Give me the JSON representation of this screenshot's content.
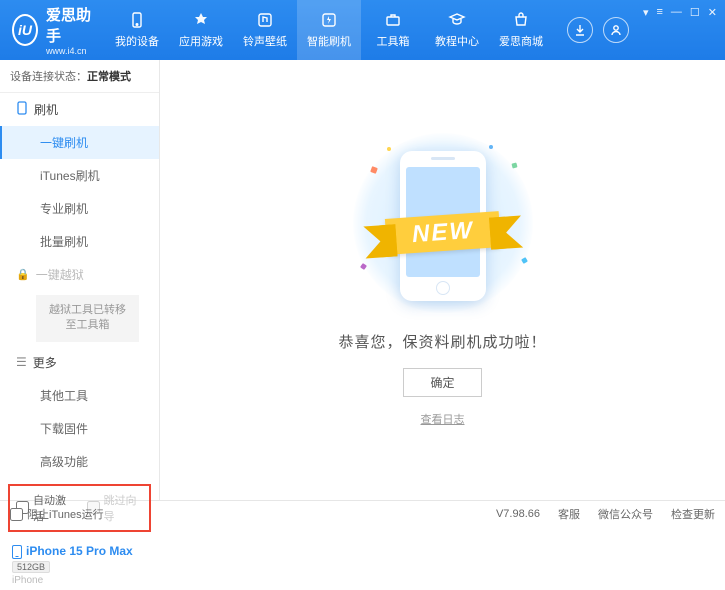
{
  "header": {
    "app_name": "爱思助手",
    "app_url": "www.i4.cn",
    "logo_letter": "iU"
  },
  "nav": [
    {
      "label": "我的设备"
    },
    {
      "label": "应用游戏"
    },
    {
      "label": "铃声壁纸"
    },
    {
      "label": "智能刷机",
      "active": true
    },
    {
      "label": "工具箱"
    },
    {
      "label": "教程中心"
    },
    {
      "label": "爱思商城"
    }
  ],
  "sidebar": {
    "conn_label": "设备连接状态：",
    "conn_value": "正常模式",
    "group_flash": "刷机",
    "items_flash": [
      {
        "label": "一键刷机",
        "active": true
      },
      {
        "label": "iTunes刷机"
      },
      {
        "label": "专业刷机"
      },
      {
        "label": "批量刷机"
      }
    ],
    "group_jailbreak": "一键越狱",
    "jailbreak_note": "越狱工具已转移至工具箱",
    "group_more": "更多",
    "items_more": [
      {
        "label": "其他工具"
      },
      {
        "label": "下载固件"
      },
      {
        "label": "高级功能"
      }
    ],
    "checkbox_auto": "自动激活",
    "checkbox_skip": "跳过向导",
    "device_name": "iPhone 15 Pro Max",
    "device_storage": "512GB",
    "device_type": "iPhone"
  },
  "main": {
    "ribbon": "NEW",
    "message": "恭喜您，保资料刷机成功啦！",
    "ok_button": "确定",
    "log_link": "查看日志"
  },
  "footer": {
    "block_itunes": "阻止iTunes运行",
    "version": "V7.98.66",
    "support": "客服",
    "wechat": "微信公众号",
    "update": "检查更新"
  }
}
